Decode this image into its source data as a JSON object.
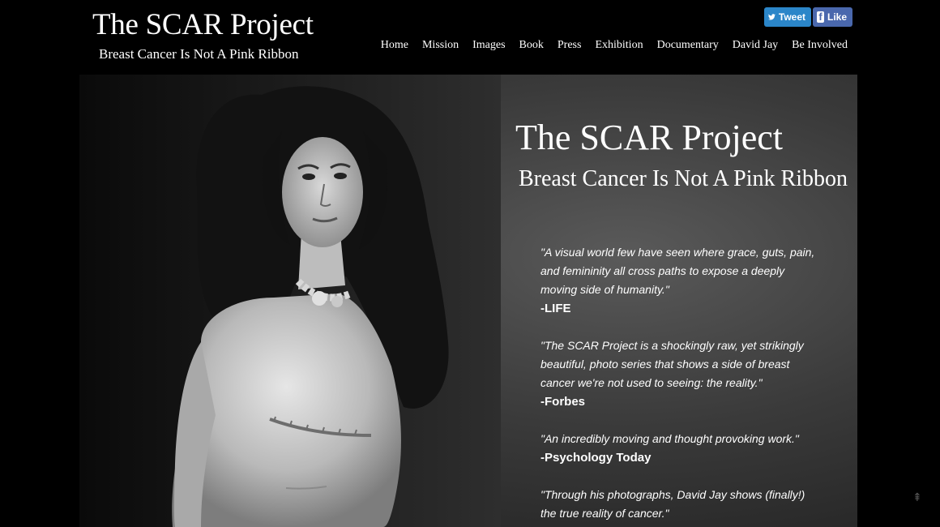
{
  "header": {
    "title": "The SCAR Project",
    "tagline": "Breast Cancer Is Not A Pink Ribbon"
  },
  "social": {
    "tweet_label": "Tweet",
    "like_label": "Like",
    "tweet_icon": "twitter-bird-icon",
    "like_icon": "facebook-f-icon"
  },
  "nav": {
    "items": [
      {
        "label": "Home"
      },
      {
        "label": "Mission"
      },
      {
        "label": "Images"
      },
      {
        "label": "Book"
      },
      {
        "label": "Press"
      },
      {
        "label": "Exhibition"
      },
      {
        "label": "Documentary"
      },
      {
        "label": "David Jay"
      },
      {
        "label": "Be Involved"
      }
    ]
  },
  "hero": {
    "title": "The SCAR Project",
    "subtitle": "Breast Cancer Is Not A Pink Ribbon",
    "quotes": [
      {
        "text": "\"A visual world few have seen where grace, guts, pain, and femininity all cross paths to expose a deeply moving side of humanity.\"",
        "source": "-LIFE"
      },
      {
        "text": "\"The SCAR Project is a shockingly raw, yet strikingly beautiful, photo series that shows a side of breast cancer we're not used to seeing: the reality.\"",
        "source": "-Forbes"
      },
      {
        "text": "\"An incredibly moving and thought provoking work.\"",
        "source": "-Psychology Today"
      },
      {
        "text": "\"Through his photographs, David Jay shows (finally!) the true reality of cancer.\"",
        "source": ""
      }
    ]
  },
  "colors": {
    "background": "#000000",
    "tweet_blue": "#2b86c9",
    "facebook_blue": "#4a68ad"
  }
}
